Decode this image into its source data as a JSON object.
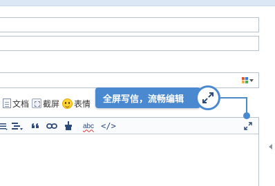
{
  "attachments": {
    "items": [
      {
        "label": "文档",
        "icon": "document-icon"
      },
      {
        "label": "截屏",
        "icon": "screenshot-icon"
      },
      {
        "label": "表情",
        "icon": "smiley-icon"
      }
    ]
  },
  "editor_toolbar": {
    "source_label": "</>",
    "spellcheck_label": "abc",
    "fullscreen_icon": "expand-icon"
  },
  "tooltip": {
    "text": "全屏写信，流畅编辑",
    "icon": "expand-icon"
  },
  "colors": {
    "accent": "#4a88cf",
    "border": "#b6c0cb",
    "top_bar": "#dce7f6"
  }
}
